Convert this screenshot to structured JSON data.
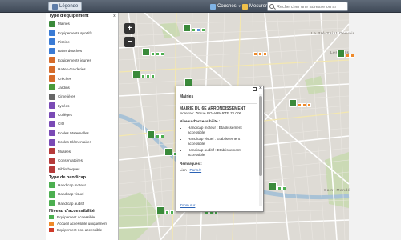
{
  "toolbar": {
    "legend_tab": "Légende",
    "layers": "Couches",
    "measure": "Mesurer",
    "search_placeholder": "Rechercher une adresse ou ar"
  },
  "sidebar": {
    "title": "Type d'équipement",
    "items": [
      {
        "label": "Mairies",
        "icon": "town-hall-icon",
        "color": "#3a8a3a"
      },
      {
        "label": "Equipements sportifs",
        "icon": "sports-icon",
        "color": "#3a7bd5"
      },
      {
        "label": "Piscine",
        "icon": "pool-icon",
        "color": "#3a7bd5"
      },
      {
        "label": "Bains douches",
        "icon": "shower-icon",
        "color": "#3a7bd5"
      },
      {
        "label": "Equipements jeunes",
        "icon": "youth-icon",
        "color": "#d66b2a"
      },
      {
        "label": "Haltes-Garderies",
        "icon": "daycare-icon",
        "color": "#d66b2a"
      },
      {
        "label": "Crèches",
        "icon": "nursery-icon",
        "color": "#d66b2a"
      },
      {
        "label": "Jardins",
        "icon": "garden-icon",
        "color": "#4a9a3a"
      },
      {
        "label": "Cimetières",
        "icon": "cemetery-icon",
        "color": "#666666"
      },
      {
        "label": "Lycées",
        "icon": "high-school-icon",
        "color": "#7a4ab5"
      },
      {
        "label": "Collèges",
        "icon": "college-icon",
        "color": "#7a4ab5"
      },
      {
        "label": "CIO",
        "icon": "cio-icon",
        "color": "#7a4ab5"
      },
      {
        "label": "Ecoles Maternelles",
        "icon": "kindergarten-icon",
        "color": "#7a4ab5"
      },
      {
        "label": "Ecoles Elémentaires",
        "icon": "elementary-school-icon",
        "color": "#7a4ab5"
      },
      {
        "label": "Musées",
        "icon": "museum-icon",
        "color": "#b53a3a"
      },
      {
        "label": "Conservatoires",
        "icon": "conservatory-icon",
        "color": "#b53a3a"
      },
      {
        "label": "Bibliothèques",
        "icon": "library-icon",
        "color": "#b53a3a"
      }
    ],
    "handicap_title": "Type de handicap",
    "handicap_items": [
      {
        "label": "Handicap moteur",
        "icon": "wheelchair-icon"
      },
      {
        "label": "Handicap visuel",
        "icon": "visual-icon"
      },
      {
        "label": "Handicap auditif",
        "icon": "hearing-icon"
      }
    ],
    "level_title": "Niveau d'accessibilité",
    "level_items": [
      {
        "label": "Equipement accessible",
        "color": "#4caf50"
      },
      {
        "label": "Accueil accessible uniquement",
        "color": "#ef8a2a"
      },
      {
        "label": "Equipement non accessible",
        "color": "#cf3b2a"
      }
    ]
  },
  "map": {
    "labels": [
      "Le Pré-Saint-Gervais",
      "Les Lilas",
      "Saint-Mandé"
    ]
  },
  "popup": {
    "title": "Mairies",
    "name": "MAIRIE DU 6E ARRONDISSEMENT",
    "address": "Adresse: 78 rue BONAPARTE 75 006",
    "level_title": "Niveau d'accessibilité :",
    "levels": [
      "Handicap moteur : Etablissement accessible",
      "Handicap visuel : Etablissement accessible",
      "Handicap auditif : Etablissement accessible"
    ],
    "remarks": "Remarques :",
    "links_label": "Lien :",
    "link": "Paris.fr",
    "zoom_link": "Zoom sur"
  }
}
